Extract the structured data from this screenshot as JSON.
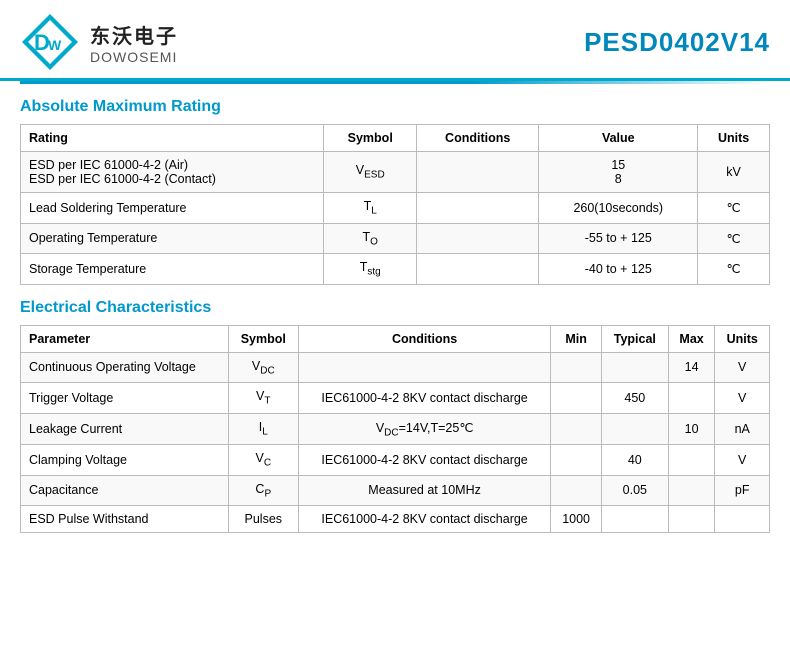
{
  "header": {
    "logo_cn": "东沃电子",
    "logo_en": "DOWOSEMI",
    "part_number": "PESD0402V14"
  },
  "section1": {
    "title": "Absolute Maximum Rating",
    "columns": [
      "Rating",
      "Symbol",
      "Conditions",
      "Value",
      "Units"
    ],
    "rows": [
      {
        "rating": "ESD per IEC 61000-4-2 (Air)\nESD per IEC 61000-4-2 (Contact)",
        "symbol": "V_ESD",
        "symbol_sub": "ESD",
        "symbol_prefix": "V",
        "conditions": "",
        "value": "15\n8",
        "units": "kV"
      },
      {
        "rating": "Lead Soldering Temperature",
        "symbol": "T_L",
        "symbol_sub": "L",
        "symbol_prefix": "T",
        "conditions": "",
        "value": "260(10seconds)",
        "units": "℃"
      },
      {
        "rating": "Operating Temperature",
        "symbol": "T_O",
        "symbol_sub": "O",
        "symbol_prefix": "T",
        "conditions": "",
        "value": "-55 to + 125",
        "units": "℃"
      },
      {
        "rating": "Storage Temperature",
        "symbol": "T_stg",
        "symbol_sub": "stg",
        "symbol_prefix": "T",
        "conditions": "",
        "value": "-40 to + 125",
        "units": "℃"
      }
    ]
  },
  "section2": {
    "title": "Electrical Characteristics",
    "columns": [
      "Parameter",
      "Symbol",
      "Conditions",
      "Min",
      "Typical",
      "Max",
      "Units"
    ],
    "rows": [
      {
        "parameter": "Continuous Operating Voltage",
        "symbol_prefix": "V",
        "symbol_sub": "DC",
        "conditions": "",
        "min": "",
        "typical": "",
        "max": "14",
        "units": "V"
      },
      {
        "parameter": "Trigger Voltage",
        "symbol_prefix": "V",
        "symbol_sub": "T",
        "conditions": "IEC61000-4-2 8KV contact discharge",
        "min": "",
        "typical": "450",
        "max": "",
        "units": "V"
      },
      {
        "parameter": "Leakage Current",
        "symbol_prefix": "I",
        "symbol_sub": "L",
        "conditions": "V_DC=14V,T=25℃",
        "conditions_sub": "DC",
        "min": "",
        "typical": "",
        "max": "10",
        "units": "nA"
      },
      {
        "parameter": "Clamping Voltage",
        "symbol_prefix": "V",
        "symbol_sub": "C",
        "conditions": "IEC61000-4-2 8KV contact discharge",
        "min": "",
        "typical": "40",
        "max": "",
        "units": "V"
      },
      {
        "parameter": "Capacitance",
        "symbol_prefix": "C",
        "symbol_sub": "P",
        "conditions": "Measured at 10MHz",
        "min": "",
        "typical": "0.05",
        "max": "",
        "units": "pF"
      },
      {
        "parameter": "ESD Pulse Withstand",
        "symbol_prefix": "Pulses",
        "symbol_sub": "",
        "conditions": "IEC61000-4-2 8KV contact discharge",
        "min": "1000",
        "typical": "",
        "max": "",
        "units": ""
      }
    ]
  }
}
